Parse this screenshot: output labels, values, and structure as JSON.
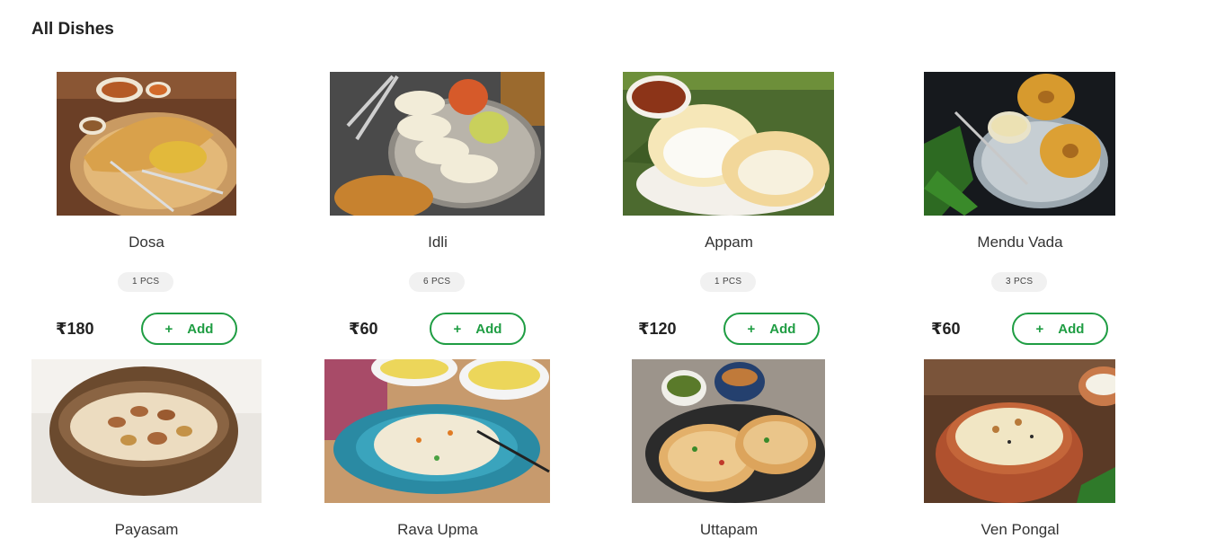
{
  "section_title": "All Dishes",
  "currency_symbol": "₹",
  "add_label": "Add",
  "add_icon": "plus-icon",
  "accent_color": "#1f9d43",
  "dishes": [
    {
      "name": "Dosa",
      "qty": "1 PCS",
      "price": "₹180",
      "image": "dosa-image"
    },
    {
      "name": "Idli",
      "qty": "6 PCS",
      "price": "₹60",
      "image": "idli-image"
    },
    {
      "name": "Appam",
      "qty": "1 PCS",
      "price": "₹120",
      "image": "appam-image"
    },
    {
      "name": "Mendu Vada",
      "qty": "3 PCS",
      "price": "₹60",
      "image": "vada-image"
    },
    {
      "name": "Payasam",
      "image": "payasam-image"
    },
    {
      "name": "Rava Upma",
      "image": "upma-image"
    },
    {
      "name": "Uttapam",
      "image": "uttapam-image"
    },
    {
      "name": "Ven Pongal",
      "image": "pongal-image"
    }
  ]
}
